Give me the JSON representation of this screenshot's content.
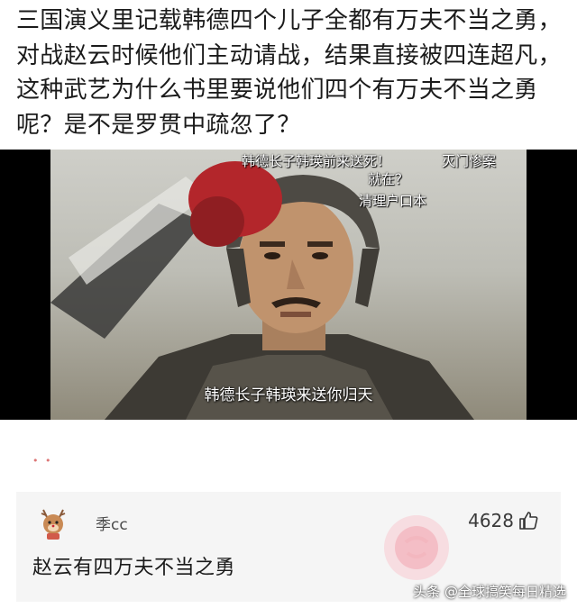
{
  "post": {
    "question": "三国演义里记载韩德四个儿子全都有万夫不当之勇，对战赵云时候他们主动请战，结果直接被四连超凡，这种武艺为什么书里要说他们四个有万夫不当之勇呢？是不是罗贯中疏忽了？"
  },
  "video": {
    "danmaku": [
      "韩德长子韩瑛前来送死！",
      "灭门惨案",
      "就在？",
      "清理户口本"
    ],
    "subtitle": "韩德长子韩瑛来送你归天"
  },
  "comment": {
    "username": "季cc",
    "likes": "4628",
    "text": "赵云有四万夫不当之勇",
    "avatar_icon": "deer-avatar-icon",
    "like_icon": "thumbs-up-icon"
  },
  "watermark": "头条 @全球搞笑每日精选"
}
